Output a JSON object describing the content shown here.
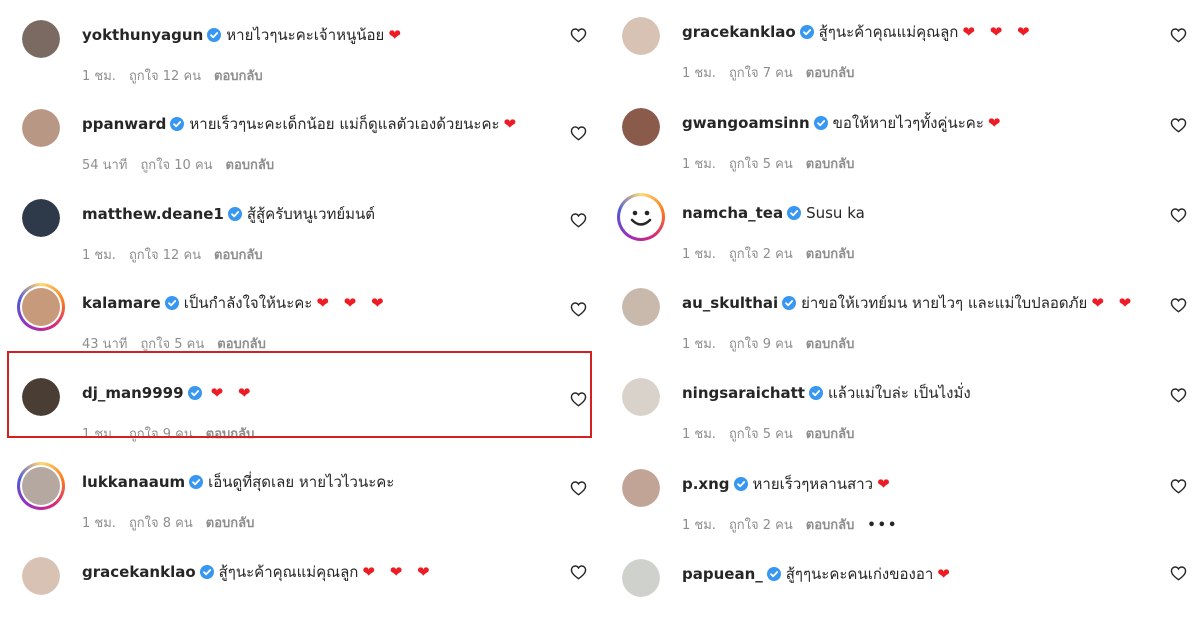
{
  "colors": {
    "verified": "#3897f0",
    "heart": "#ed1c24",
    "meta": "#8e8e8e",
    "highlight": "#d42020"
  },
  "left": [
    {
      "username": "yokthunyagun",
      "text": "หายไวๆนะคะเจ้าหนูน้อย",
      "hearts": "❤",
      "time": "1 ชม.",
      "likes": "ถูกใจ 12 คน",
      "reply": "ตอบกลับ",
      "avatar_color": "#7a6a62",
      "ring": false
    },
    {
      "username": "ppanward",
      "text": "หายเร็วๆนะคะเด็กน้อย แม่ก็ดูแลตัวเองด้วยนะคะ",
      "hearts": "❤",
      "time": "54 นาที",
      "likes": "ถูกใจ 10 คน",
      "reply": "ตอบกลับ",
      "avatar_color": "#b89884",
      "ring": false
    },
    {
      "username": "matthew.deane1",
      "text": "สู้สู้ครับหนูเวทย์มนต์",
      "hearts": "",
      "time": "1 ชม.",
      "likes": "ถูกใจ 12 คน",
      "reply": "ตอบกลับ",
      "avatar_color": "#2e3a4a",
      "ring": false
    },
    {
      "username": "kalamare",
      "text": "เป็นกำลังใจให้นะคะ",
      "hearts": "❤ ❤ ❤",
      "time": "43 นาที",
      "likes": "ถูกใจ 5 คน",
      "reply": "ตอบกลับ",
      "avatar_color": "#c79a7b",
      "ring": true
    },
    {
      "username": "dj_man9999",
      "text": "",
      "hearts": "❤ ❤",
      "time": "1 ชม.",
      "likes": "ถูกใจ 9 คน",
      "reply": "ตอบกลับ",
      "avatar_color": "#4a3e34",
      "ring": false
    },
    {
      "username": "lukkanaaum",
      "text": "เอ็นดูที่สุดเลย หายไวไวนะคะ",
      "hearts": "",
      "time": "1 ชม.",
      "likes": "ถูกใจ 8 คน",
      "reply": "ตอบกลับ",
      "avatar_color": "#b5a8a0",
      "ring": true
    },
    {
      "username": "gracekanklao",
      "text": "สู้ๆนะค้าคุณแม่คุณลูก",
      "hearts": "❤ ❤ ❤",
      "time": "",
      "likes": "",
      "reply": "",
      "avatar_color": "#d8c2b4",
      "ring": false
    }
  ],
  "right": [
    {
      "username": "gracekanklao",
      "text": "สู้ๆนะค้าคุณแม่คุณลูก",
      "hearts": "❤ ❤ ❤",
      "time": "1 ชม.",
      "likes": "ถูกใจ 7 คน",
      "reply": "ตอบกลับ",
      "avatar_color": "#d8c2b4",
      "ring": false,
      "more": ""
    },
    {
      "username": "gwangoamsinn",
      "text": "ขอให้หายไวๆทั้งคู่นะคะ",
      "hearts": "❤",
      "time": "1 ชม.",
      "likes": "ถูกใจ 5 คน",
      "reply": "ตอบกลับ",
      "avatar_color": "#8a5a4a",
      "ring": false,
      "more": ""
    },
    {
      "username": "namcha_tea",
      "text": "Susu ka",
      "hearts": "",
      "time": "1 ชม.",
      "likes": "ถูกใจ 2 คน",
      "reply": "ตอบกลับ",
      "avatar_color": "#ffffff",
      "ring": true,
      "smiley": true,
      "more": ""
    },
    {
      "username": "au_skulthai",
      "text": "ย่าขอให้เวทย์มน หายไวๆ และแม่ใบปลอดภัย",
      "hearts": "❤ ❤",
      "time": "1 ชม.",
      "likes": "ถูกใจ 9 คน",
      "reply": "ตอบกลับ",
      "avatar_color": "#c9b9ac",
      "ring": false,
      "more": ""
    },
    {
      "username": "ningsaraichatt",
      "text": "แล้วแม่ใบล่ะ เป็นไงมั่ง",
      "hearts": "",
      "time": "1 ชม.",
      "likes": "ถูกใจ 5 คน",
      "reply": "ตอบกลับ",
      "avatar_color": "#d9d2ca",
      "ring": false,
      "more": ""
    },
    {
      "username": "p.xng",
      "text": "หายเร็วๆหลานสาว",
      "hearts": "❤",
      "time": "1 ชม.",
      "likes": "ถูกใจ 2 คน",
      "reply": "ตอบกลับ",
      "avatar_color": "#c2a497",
      "ring": false,
      "more": "•••"
    },
    {
      "username": "papuean_",
      "text": "สู้ๆๆนะคะคนเก่งของอา",
      "hearts": "❤",
      "time": "",
      "likes": "",
      "reply": "",
      "avatar_color": "#cfd2cc",
      "ring": false,
      "more": ""
    }
  ]
}
